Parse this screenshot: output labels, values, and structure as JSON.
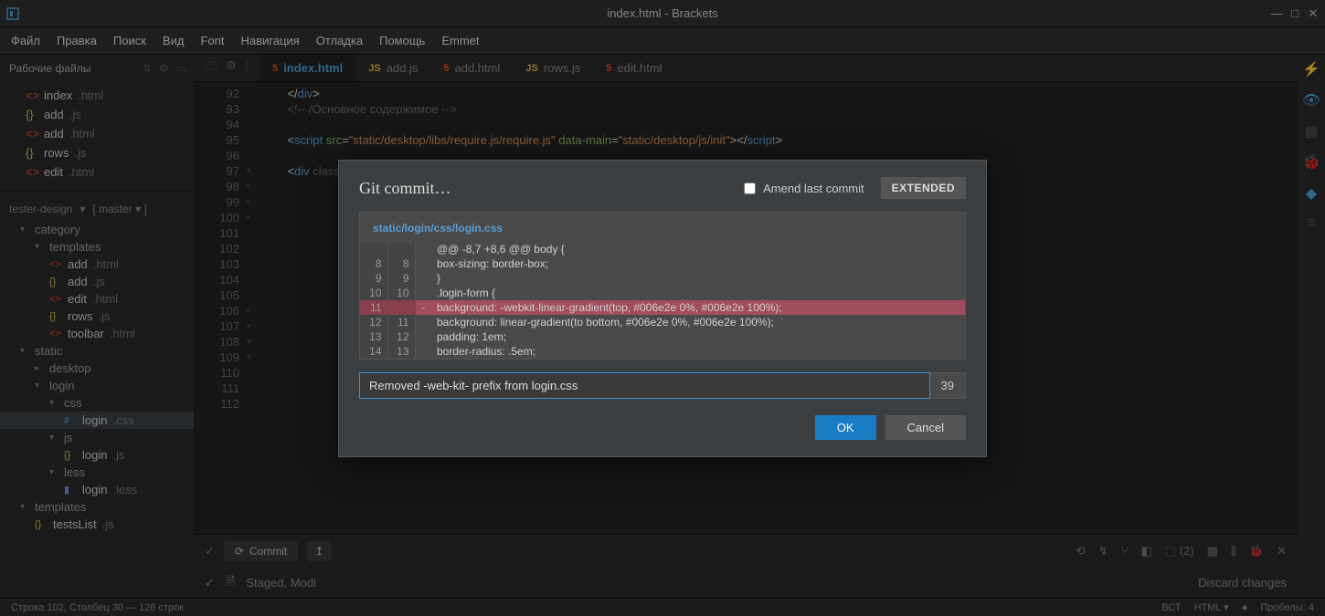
{
  "titlebar": {
    "title": "index.html - Brackets"
  },
  "menus": [
    "Файл",
    "Правка",
    "Поиск",
    "Вид",
    "Font",
    "Навигация",
    "Отладка",
    "Помощь",
    "Emmet"
  ],
  "sidebar": {
    "workingHeader": "Рабочие файлы",
    "workingFiles": [
      {
        "name": "index",
        "ext": ".html",
        "cls": "icon-html"
      },
      {
        "name": "add",
        "ext": ".js",
        "cls": "icon-js"
      },
      {
        "name": "add",
        "ext": ".html",
        "cls": "icon-html"
      },
      {
        "name": "rows",
        "ext": ".js",
        "cls": "icon-js"
      },
      {
        "name": "edit",
        "ext": ".html",
        "cls": "icon-html"
      }
    ],
    "gitProject": "tester-design",
    "gitBranch": "[ master ▾ ]",
    "tree": [
      {
        "d": 0,
        "caret": "▾",
        "label": "category",
        "folder": true
      },
      {
        "d": 1,
        "caret": "▾",
        "label": "templates",
        "folder": true
      },
      {
        "d": 2,
        "name": "add",
        "ext": ".html",
        "cls": "icon-html"
      },
      {
        "d": 2,
        "name": "add",
        "ext": ".js",
        "cls": "icon-js"
      },
      {
        "d": 2,
        "name": "edit",
        "ext": ".html",
        "cls": "icon-html"
      },
      {
        "d": 2,
        "name": "rows",
        "ext": ".js",
        "cls": "icon-js"
      },
      {
        "d": 2,
        "name": "toolbar",
        "ext": ".html",
        "cls": "icon-html"
      },
      {
        "d": 0,
        "caret": "▾",
        "label": "static",
        "folder": true
      },
      {
        "d": 1,
        "caret": "▸",
        "label": "desktop",
        "folder": true
      },
      {
        "d": 1,
        "caret": "▾",
        "label": "login",
        "folder": true
      },
      {
        "d": 2,
        "caret": "▾",
        "label": "css",
        "folder": true
      },
      {
        "d": 3,
        "name": "login",
        "ext": ".css",
        "cls": "icon-css",
        "sel": true
      },
      {
        "d": 2,
        "caret": "▾",
        "label": "js",
        "folder": true
      },
      {
        "d": 3,
        "name": "login",
        "ext": ".js",
        "cls": "icon-js"
      },
      {
        "d": 2,
        "caret": "▾",
        "label": "less",
        "folder": true
      },
      {
        "d": 3,
        "name": "login",
        "ext": ".less",
        "cls": "icon-less"
      },
      {
        "d": 0,
        "caret": "▾",
        "label": "templates",
        "folder": true
      },
      {
        "d": 1,
        "name": "testsList",
        "ext": ".js",
        "cls": "icon-js"
      }
    ]
  },
  "tabs": [
    {
      "label": "index.html",
      "icon": "5",
      "cls": "icon-html",
      "active": true
    },
    {
      "label": "add.js",
      "icon": "JS",
      "cls": "icon-js"
    },
    {
      "label": "add.html",
      "icon": "5",
      "cls": "icon-html"
    },
    {
      "label": "rows.js",
      "icon": "JS",
      "cls": "icon-js"
    },
    {
      "label": "edit.html",
      "icon": "5",
      "cls": "icon-html"
    }
  ],
  "code": {
    "lines": [
      {
        "n": 92,
        "html": "    <span class='c-br'>&lt;/</span><span class='c-tag'>div</span><span class='c-br'>&gt;</span>"
      },
      {
        "n": 93,
        "html": "    <span class='c-cmt'>&lt;!-- /Основное содержимое --&gt;</span>"
      },
      {
        "n": 94,
        "html": ""
      },
      {
        "n": 95,
        "html": "    <span class='c-br'>&lt;</span><span class='c-tag'>script</span> <span class='c-attr'>src</span>=<span class='c-str'>\"static/desktop/libs/require.js/require.js\"</span> <span class='c-attr'>data-main</span>=<span class='c-str'>\"static/desktop/js/init\"</span><span class='c-br'>&gt;&lt;/</span><span class='c-tag'>script</span><span class='c-br'>&gt;</span>"
      },
      {
        "n": 96,
        "html": ""
      },
      {
        "n": 97,
        "fold": "▾",
        "html": "    <span class='c-br'>&lt;</span><span class='c-tag'>div</span> <span class='c-cmt'>class=\"modal\" id=\"test-new-modal\" role=\"dialog\"&gt;</span>"
      },
      {
        "n": 98,
        "fold": "▾",
        "html": ""
      },
      {
        "n": 99,
        "fold": "▾",
        "html": ""
      },
      {
        "n": 100,
        "fold": "▾",
        "html": ""
      },
      {
        "n": 101,
        "html": ""
      },
      {
        "n": 102,
        "html": ""
      },
      {
        "n": 103,
        "html": ""
      },
      {
        "n": 104,
        "html": ""
      },
      {
        "n": 105,
        "html": ""
      },
      {
        "n": 106,
        "fold": "▾",
        "html": ""
      },
      {
        "n": 107,
        "fold": "▾",
        "html": ""
      },
      {
        "n": 108,
        "fold": "▾",
        "html": ""
      },
      {
        "n": 109,
        "fold": "▾",
        "html": ""
      },
      {
        "n": 110,
        "html": ""
      },
      {
        "n": 111,
        "html": "                                                                                               <span class='c-br'>/&gt;</span>"
      },
      {
        "n": 112,
        "html": ""
      }
    ]
  },
  "gitPanel": {
    "commitBtn": "Commit",
    "stagedRow": "Staged, Modi",
    "discard": "Discard changes",
    "badge": "(2)"
  },
  "status": {
    "left": "Строка 102, Столбец 30 — 126 строк",
    "items": [
      "ВСТ",
      "HTML ▾",
      "●",
      "Пробелы: 4"
    ]
  },
  "modal": {
    "title": "Git commit…",
    "amend": "Amend last commit",
    "extended": "EXTENDED",
    "file": "static/login/css/login.css",
    "diffHeader": "@@ -8,7 +8,6 @@ body {",
    "rows": [
      {
        "a": "8",
        "b": "8",
        "s": "",
        "t": "    box-sizing: border-box;"
      },
      {
        "a": "9",
        "b": "9",
        "s": "",
        "t": "}"
      },
      {
        "a": "10",
        "b": "10",
        "s": "",
        "t": ".login-form {"
      },
      {
        "a": "11",
        "b": "",
        "s": "-",
        "t": "    background: -webkit-linear-gradient(top, #006e2e 0%, #006e2e 100%);",
        "del": true
      },
      {
        "a": "12",
        "b": "11",
        "s": "",
        "t": "    background: linear-gradient(to bottom, #006e2e 0%, #006e2e 100%);"
      },
      {
        "a": "13",
        "b": "12",
        "s": "",
        "t": "    padding: 1em;"
      },
      {
        "a": "14",
        "b": "13",
        "s": "",
        "t": "    border-radius: .5em;"
      }
    ],
    "commitMsg": "Removed -web-kit- prefix from login.css",
    "count": "39",
    "ok": "OK",
    "cancel": "Cancel"
  }
}
